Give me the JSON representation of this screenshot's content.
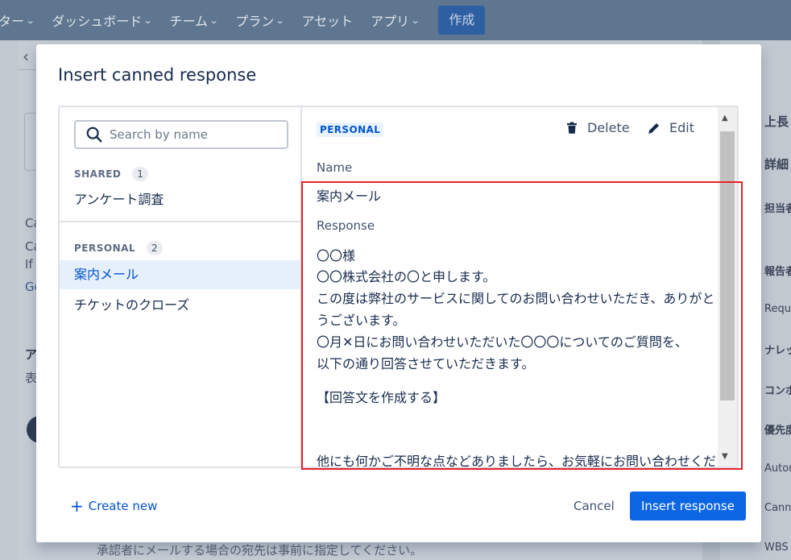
{
  "background": {
    "nav": [
      {
        "label": "ター"
      },
      {
        "label": "ダッシュボード"
      },
      {
        "label": "チーム"
      },
      {
        "label": "プラン"
      },
      {
        "label": "アセット"
      },
      {
        "label": "アプリ"
      }
    ],
    "create_label": "作成",
    "left_fragments": [
      "Ca",
      "Ca",
      "If",
      "Go",
      "ア",
      "表"
    ],
    "right_fragments": [
      "上長",
      "詳細",
      "担当者",
      "報告者",
      "Reque",
      "ナレッ",
      "コンポ",
      "優先度",
      "Autom",
      "Canne",
      "WBS ("
    ],
    "bottom_fragment": "承認者にメールする場合の宛先は事前に指定してください。"
  },
  "modal": {
    "title": "Insert canned response",
    "search": {
      "placeholder": "Search by name",
      "value": ""
    },
    "shared": {
      "heading": "SHARED",
      "count": "1",
      "items": [
        {
          "label": "アンケート調査"
        }
      ]
    },
    "personal": {
      "heading": "PERSONAL",
      "count": "2",
      "items": [
        {
          "label": "案内メール",
          "selected": true
        },
        {
          "label": "チケットのクローズ",
          "selected": false
        }
      ]
    },
    "detail": {
      "badge": "PERSONAL",
      "delete_label": "Delete",
      "edit_label": "Edit",
      "name_label": "Name",
      "name_value": "案内メール",
      "response_label": "Response",
      "response_lines": [
        "〇〇様",
        "〇〇株式会社の〇と申します。",
        "この度は弊社のサービスに関してのお問い合わせいただき、ありがと",
        "うございます。",
        "〇月✕日にお問い合わせいただいた〇〇〇についてのご質問を、",
        "以下の通り回答させていただきます。",
        "【回答文を作成する】",
        "他にも何かご不明な点などありましたら、お気軽にお問い合わせくだ"
      ]
    },
    "create_new_label": "Create new",
    "cancel_label": "Cancel",
    "insert_label": "Insert response"
  },
  "colors": {
    "primary": "#0c66e4",
    "link": "#0052cc",
    "selected_bg": "#e6effc",
    "highlight": "#e8202a"
  }
}
